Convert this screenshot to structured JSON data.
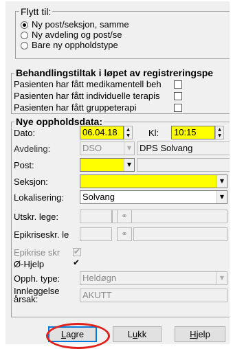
{
  "flytt": {
    "legend": "Flytt til:",
    "options": [
      {
        "label": "Ny post/seksjon, samme",
        "checked": true
      },
      {
        "label": "Ny avdeling og post/se",
        "checked": false
      },
      {
        "label": "Bare ny oppholdstype",
        "checked": false
      }
    ]
  },
  "behandling": {
    "legend": "Behandlingstiltak i løpet av registreringspe",
    "rows": [
      {
        "label": "Pasienten har fått medikamentell beh",
        "checked": false
      },
      {
        "label": "Pasienten har fått individuelle terapis",
        "checked": false
      },
      {
        "label": "Pasienten har fått gruppeterapi",
        "checked": false
      }
    ]
  },
  "nye": {
    "legend": "Nye oppholdsdata:",
    "dato_label": "Dato:",
    "dato_value": "06.04.18",
    "kl_label": "Kl:",
    "kl_value": "10:15",
    "avdeling_label": "Avdeling:",
    "avdeling_code": "DSO",
    "avdeling_name": "DPS Solvang",
    "post_label": "Post:",
    "post_value": "",
    "seksjon_label": "Seksjon:",
    "seksjon_value": "",
    "lokalisering_label": "Lokalisering:",
    "lokalisering_value": "Solvang",
    "utskr_label": "Utskr. lege:",
    "epikriseskr_label": "Epikriseskr. le",
    "epikrise_skr_label": "Epikrise skr",
    "epikrise_skr_checked": true,
    "ohjelp_label": "Ø-Hjelp",
    "ohjelp_checked": true,
    "opph_type_label": "Opph. type:",
    "opph_type_value": "Heldøgn",
    "innleggelse_label_1": "Innleggelse",
    "innleggelse_label_2": "årsak:",
    "innleggelse_value": "AKUTT"
  },
  "buttons": {
    "lagre": {
      "pre": "",
      "key": "L",
      "post": "agre"
    },
    "lukk": {
      "pre": "L",
      "key": "u",
      "post": "kk"
    },
    "hjelp": {
      "pre": "",
      "key": "H",
      "post": "jelp"
    }
  },
  "colors": {
    "required_field": "#ffff00",
    "highlight": "#e0201a"
  }
}
